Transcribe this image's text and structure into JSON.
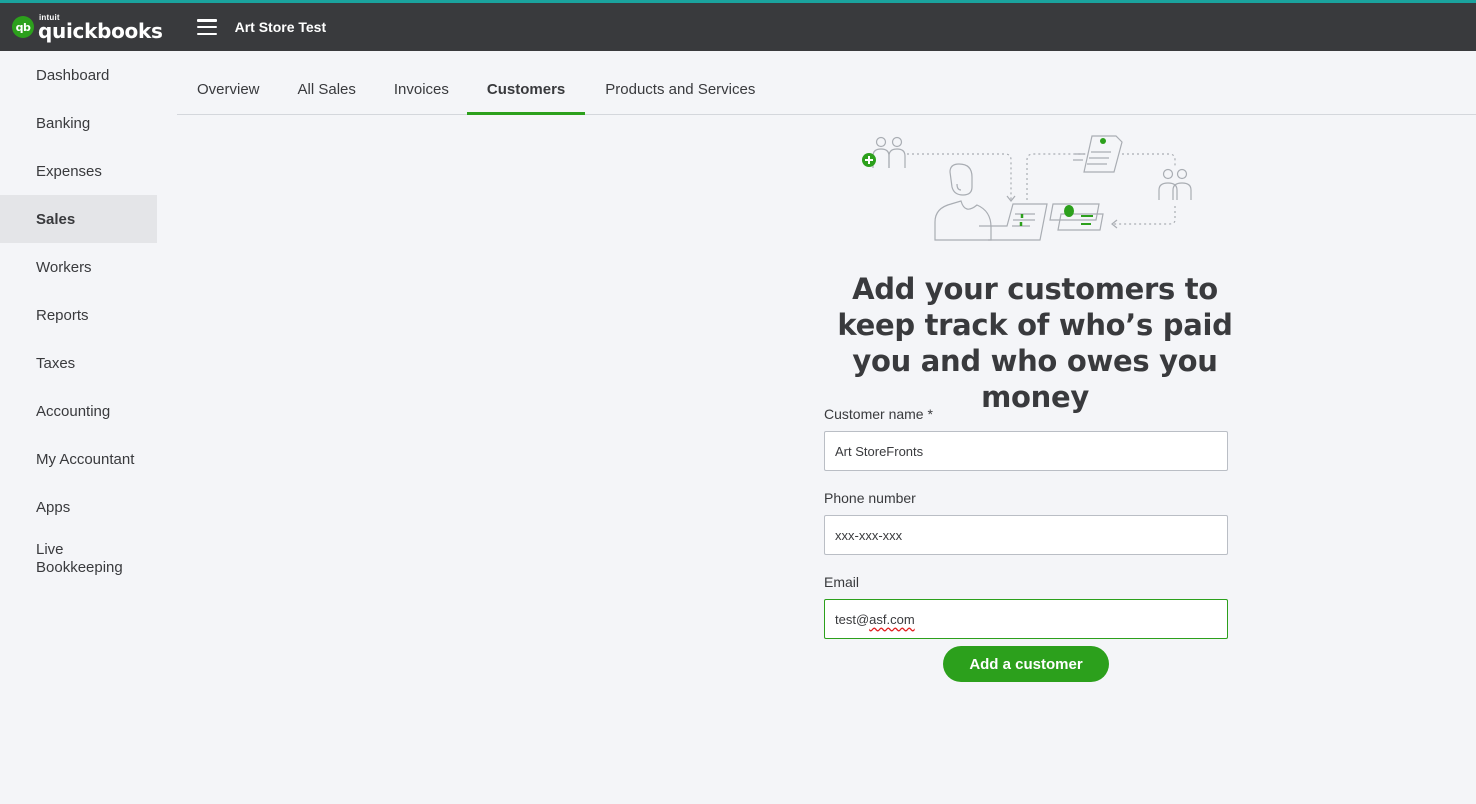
{
  "header": {
    "logo_brand_small": "intuit",
    "logo_brand": "quickbooks",
    "logo_mark": "qb",
    "company_name": "Art Store Test",
    "accent_color": "#1aa39e"
  },
  "sidebar": {
    "items": [
      {
        "label": "Dashboard"
      },
      {
        "label": "Banking"
      },
      {
        "label": "Expenses"
      },
      {
        "label": "Sales",
        "active": true
      },
      {
        "label": "Workers"
      },
      {
        "label": "Reports"
      },
      {
        "label": "Taxes"
      },
      {
        "label": "Accounting"
      },
      {
        "label": "My Accountant"
      },
      {
        "label": "Apps"
      },
      {
        "label_line1": "Live",
        "label_line2": "Bookkeeping"
      }
    ]
  },
  "tabs": [
    {
      "label": "Overview"
    },
    {
      "label": "All Sales"
    },
    {
      "label": "Invoices"
    },
    {
      "label": "Customers",
      "active": true
    },
    {
      "label": "Products and Services"
    }
  ],
  "main": {
    "headline": "Add your customers to keep track of who’s paid you and who owes you money",
    "form": {
      "customer_name_label": "Customer name *",
      "customer_name_value": "Art StoreFronts",
      "phone_label": "Phone number",
      "phone_value": "xxx-xxx-xxx",
      "email_label": "Email",
      "email_value_prefix": "test@",
      "email_value_misspelled": "asf.com"
    },
    "submit_label": "Add a customer",
    "primary_color": "#2ca01c"
  }
}
